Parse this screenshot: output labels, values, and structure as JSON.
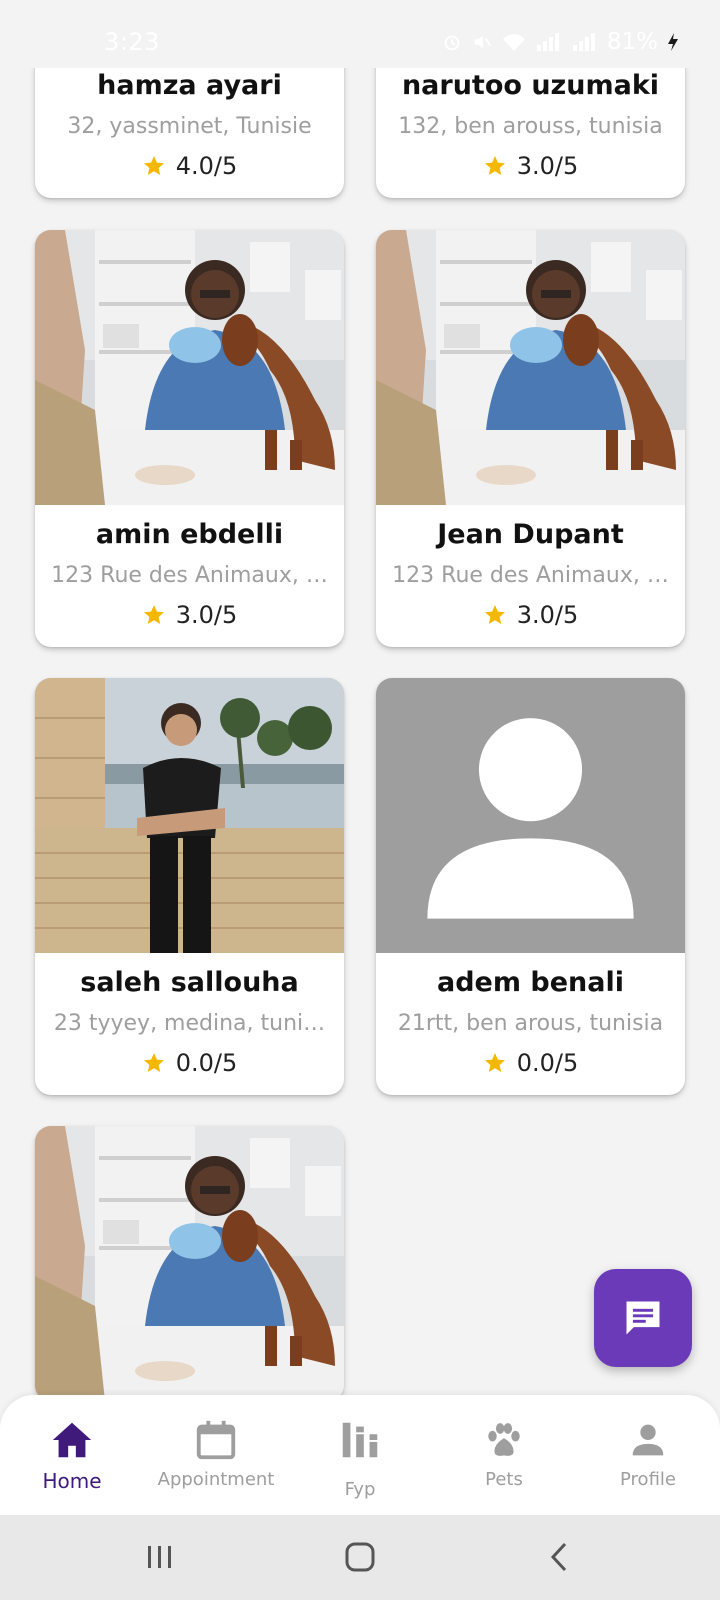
{
  "status_bar": {
    "time": "3:23",
    "battery": "81%"
  },
  "vets": [
    {
      "name": "hamza ayari",
      "address": "32, yassminet, Tunisie",
      "rating": "4.0/5",
      "photo": "none-visible"
    },
    {
      "name": "narutoo uzumaki",
      "address": "132, ben arouss, tunisia",
      "rating": "3.0/5",
      "photo": "none-visible"
    },
    {
      "name": "amin ebdelli",
      "address": "123 Rue des Animaux, …",
      "rating": "3.0/5",
      "photo": "vet-with-dog"
    },
    {
      "name": "Jean Dupant",
      "address": "123 Rue des Animaux, …",
      "rating": "3.0/5",
      "photo": "vet-with-dog"
    },
    {
      "name": "saleh sallouha",
      "address": "23 tyyey, medina, tuni…",
      "rating": "0.0/5",
      "photo": "man-by-stone-wall"
    },
    {
      "name": "adem benali",
      "address": "21rtt, ben arous, tunisia",
      "rating": "0.0/5",
      "photo": "placeholder-person"
    },
    {
      "name": "",
      "address": "",
      "rating": "",
      "photo": "vet-with-dog"
    }
  ],
  "fab": {
    "icon": "chat-icon"
  },
  "bottom_nav": {
    "items": [
      {
        "label": "Home",
        "icon": "home-icon",
        "active": true
      },
      {
        "label": "Appointment",
        "icon": "calendar-icon",
        "active": false
      },
      {
        "label": "Fyp",
        "icon": "bar-chart-icon",
        "active": false
      },
      {
        "label": "Pets",
        "icon": "paw-icon",
        "active": false
      },
      {
        "label": "Profile",
        "icon": "person-icon",
        "active": false
      }
    ]
  },
  "colors": {
    "accent": "#6a3ab8",
    "active_nav": "#3f1a7a",
    "inactive_nav": "#9e9e9e",
    "star": "#f5b800",
    "background": "#f3f3f3"
  }
}
